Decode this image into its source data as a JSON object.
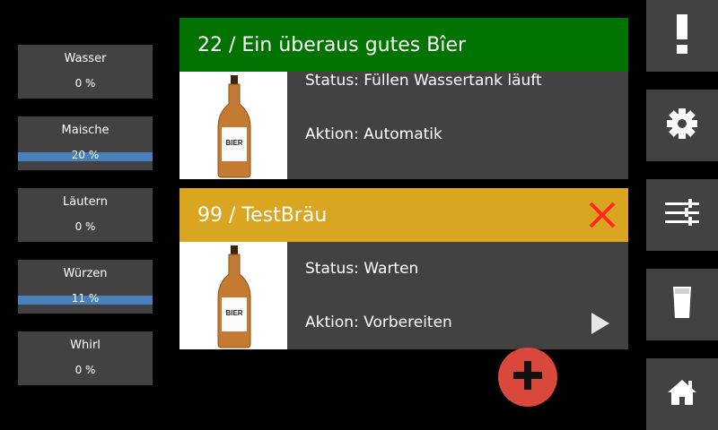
{
  "stages": [
    {
      "name": "Wasser",
      "progress": "0 %",
      "progress_fraction": 0
    },
    {
      "name": "Maische",
      "progress": "20 %",
      "progress_fraction": 1
    },
    {
      "name": "Läutern",
      "progress": "0 %",
      "progress_fraction": 0
    },
    {
      "name": "Würzen",
      "progress": "11 %",
      "progress_fraction": 1
    },
    {
      "name": "Whirl",
      "progress": "0 %",
      "progress_fraction": 0
    }
  ],
  "brews": [
    {
      "title": "22 / Ein überaus gutes Bîer",
      "header_color": "#007300",
      "status": "Status: Füllen Wassertank läuft",
      "action": "Aktion: Automatik",
      "label": "BIER"
    },
    {
      "title": "99 / TestBräu",
      "header_color": "#daa520",
      "status": "Status: Warten",
      "action": "Aktion: Vorbereiten",
      "label": "BIER"
    }
  ],
  "colors": {
    "panel": "#444142",
    "accent_blue": "#4a7fb8",
    "danger": "#ff2a1a",
    "fab": "#d9483b"
  },
  "sidebar_icons": [
    "alert-icon",
    "gear-icon",
    "sliders-icon",
    "beer-glass-icon",
    "home-icon"
  ]
}
